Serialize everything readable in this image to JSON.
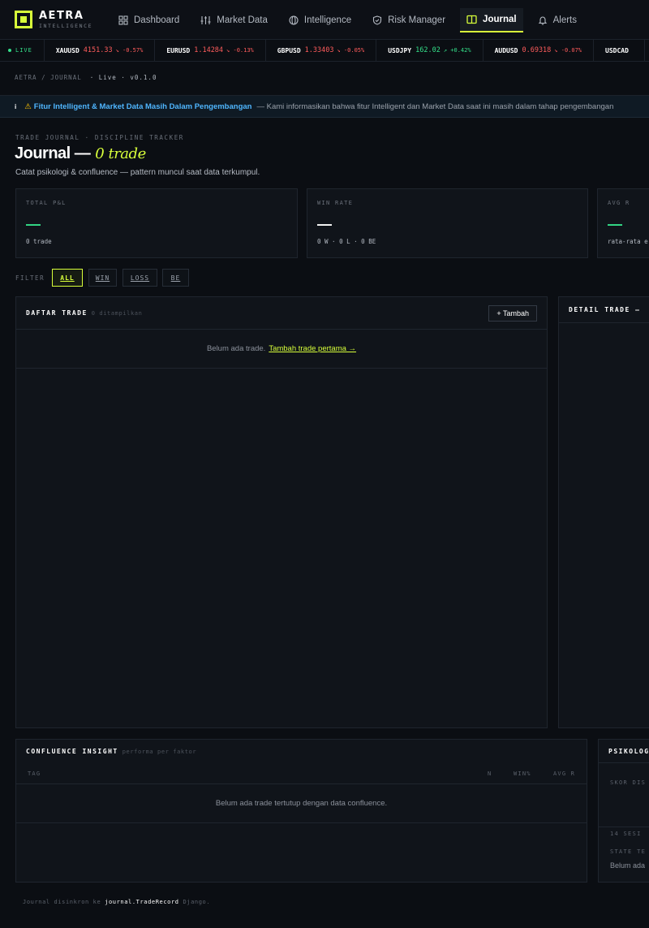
{
  "brand": {
    "name": "AETRA",
    "sub": "INTELLIGENCE"
  },
  "nav": {
    "items": [
      {
        "label": "Dashboard",
        "icon": "grid-icon"
      },
      {
        "label": "Market Data",
        "icon": "sliders-icon"
      },
      {
        "label": "Intelligence",
        "icon": "globe-icon"
      },
      {
        "label": "Risk Manager",
        "icon": "shield-icon"
      },
      {
        "label": "Journal",
        "icon": "book-icon",
        "active": true
      },
      {
        "label": "Alerts",
        "icon": "bell-icon"
      }
    ]
  },
  "ticker": {
    "live_label": "LIVE",
    "items": [
      {
        "symbol": "XAUUSD",
        "price": "4151.33",
        "change": "↘ -0.57%",
        "direction": "down"
      },
      {
        "symbol": "EURUSD",
        "price": "1.14284",
        "change": "↘ -0.13%",
        "direction": "down"
      },
      {
        "symbol": "GBPUSD",
        "price": "1.33403",
        "change": "↘ -0.05%",
        "direction": "down"
      },
      {
        "symbol": "USDJPY",
        "price": "162.02",
        "change": "↗ +0.42%",
        "direction": "up"
      },
      {
        "symbol": "AUDUSD",
        "price": "0.69318",
        "change": "↘ -0.07%",
        "direction": "down"
      },
      {
        "symbol": "USDCAD",
        "price": "",
        "change": "",
        "direction": "down"
      }
    ]
  },
  "breadcrumb": {
    "path": "AETRA / JOURNAL",
    "status": "· Live · v0.1.0"
  },
  "banner": {
    "icon": "i",
    "title": "Fitur Intelligent & Market Data Masih Dalam Pengembangan",
    "text": "— Kami informasikan bahwa fitur Intelligent dan Market Data saat ini masih dalam tahap pengembangan"
  },
  "header": {
    "eyebrow": "TRADE JOURNAL · DISCIPLINE TRACKER",
    "title": "Journal —",
    "count": "0 trade",
    "subtitle": "Catat psikologi & confluence — pattern muncul saat data terkumpul."
  },
  "stats": [
    {
      "label": "TOTAL P&L",
      "value": "—",
      "sub": "0 trade"
    },
    {
      "label": "WIN RATE",
      "value": "—",
      "sub": "0 W · 0 L · 0 BE"
    },
    {
      "label": "AVG R",
      "value": "—",
      "sub": "rata-rata e"
    }
  ],
  "colors": {
    "accent": "#d8ff3a",
    "positive": "#34e08a",
    "negative": "#ff5c5c",
    "info": "#4fb6ff"
  },
  "filter": {
    "label": "FILTER",
    "options": [
      {
        "label": "ALL",
        "active": true
      },
      {
        "label": "WIN"
      },
      {
        "label": "LOSS"
      },
      {
        "label": "BE"
      }
    ]
  },
  "trade_list": {
    "title": "DAFTAR TRADE",
    "count": "0 ditampilkan",
    "add_label": "+ Tambah",
    "empty_text": "Belum ada trade.",
    "empty_link": "Tambah trade pertama →"
  },
  "detail": {
    "title": "DETAIL TRADE —"
  },
  "confluence": {
    "title": "CONFLUENCE INSIGHT",
    "subtitle": "performa per faktor",
    "columns": [
      "TAG",
      "N",
      "WIN%",
      "AVG R"
    ],
    "empty_text": "Belum ada trade tertutup dengan data confluence."
  },
  "psychology": {
    "title": "PSIKOLOG",
    "score_label": "SKOR DIS",
    "sessions_label": "14 SESI",
    "state_label": "STATE TE",
    "state_value": "Belum ada"
  },
  "footer": {
    "prefix": "Journal disinkron ke",
    "model": "journal.TradeRecord",
    "suffix": "Django."
  }
}
